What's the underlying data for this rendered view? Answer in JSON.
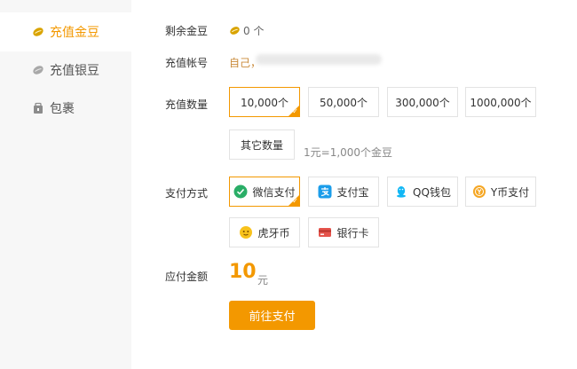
{
  "sidebar": {
    "items": [
      {
        "label": "充值金豆",
        "active": true
      },
      {
        "label": "充值银豆",
        "active": false
      },
      {
        "label": "包裹",
        "active": false
      }
    ]
  },
  "balance": {
    "label": "剩余金豆",
    "value": "0 个"
  },
  "account": {
    "label": "充值帐号",
    "value": "自己，"
  },
  "quantity": {
    "label": "充值数量",
    "options": [
      "10,000个",
      "50,000个",
      "300,000个",
      "1000,000个"
    ],
    "other": "其它数量",
    "rate": "1元=1,000个金豆"
  },
  "payment": {
    "label": "支付方式",
    "options": [
      "微信支付",
      "支付宝",
      "QQ钱包",
      "Y币支付",
      "虎牙币",
      "银行卡"
    ]
  },
  "amount": {
    "label": "应付金额",
    "value": "10",
    "unit": "元"
  },
  "submit_label": "前往支付",
  "colors": {
    "accent": "#f39800",
    "wechat": "#2aae67",
    "alipay": "#1b9dea",
    "qq": "#12b7f5",
    "ycoin": "#f5a623",
    "huya": "#f8c21c",
    "bank": "#e5534b"
  }
}
